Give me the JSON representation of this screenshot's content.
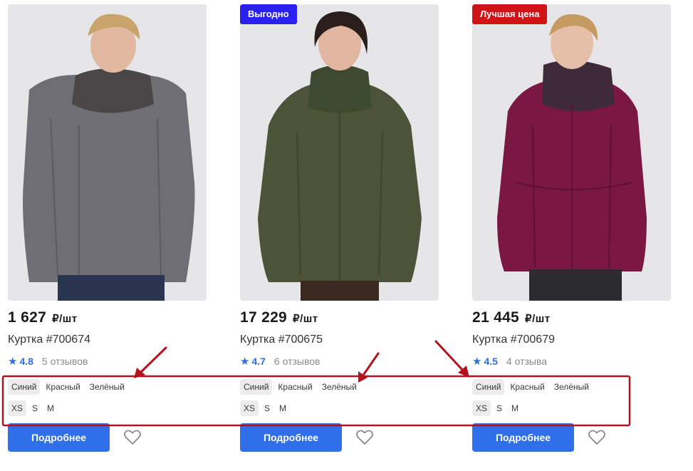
{
  "colors": {
    "primary_button": "#2f6fea",
    "star": "#2f6fe0",
    "badge_blue": "#2a21f0",
    "badge_red": "#d01317",
    "annotation": "#b3121f"
  },
  "products": [
    {
      "badge": "",
      "price": "1 627",
      "price_unit": "₽/шт",
      "title": "Куртка #700674",
      "rating": "4.8",
      "reviews": "5 отзывов",
      "colors": [
        "Синий",
        "Красный",
        "Зелёный"
      ],
      "sizes": [
        "XS",
        "S",
        "M"
      ],
      "button": "Подробнее",
      "jacket_color": "grey"
    },
    {
      "badge": "Выгодно",
      "price": "17 229",
      "price_unit": "₽/шт",
      "title": "Куртка #700675",
      "rating": "4.7",
      "reviews": "6 отзывов",
      "colors": [
        "Синий",
        "Красный",
        "Зелёный"
      ],
      "sizes": [
        "XS",
        "S",
        "M"
      ],
      "button": "Подробнее",
      "jacket_color": "olive"
    },
    {
      "badge": "Лучшая цена",
      "price": "21 445",
      "price_unit": "₽/шт",
      "title": "Куртка #700679",
      "rating": "4.5",
      "reviews": "4 отзыва",
      "colors": [
        "Синий",
        "Красный",
        "Зелёный"
      ],
      "sizes": [
        "XS",
        "S",
        "M"
      ],
      "button": "Подробнее",
      "jacket_color": "magenta"
    }
  ]
}
